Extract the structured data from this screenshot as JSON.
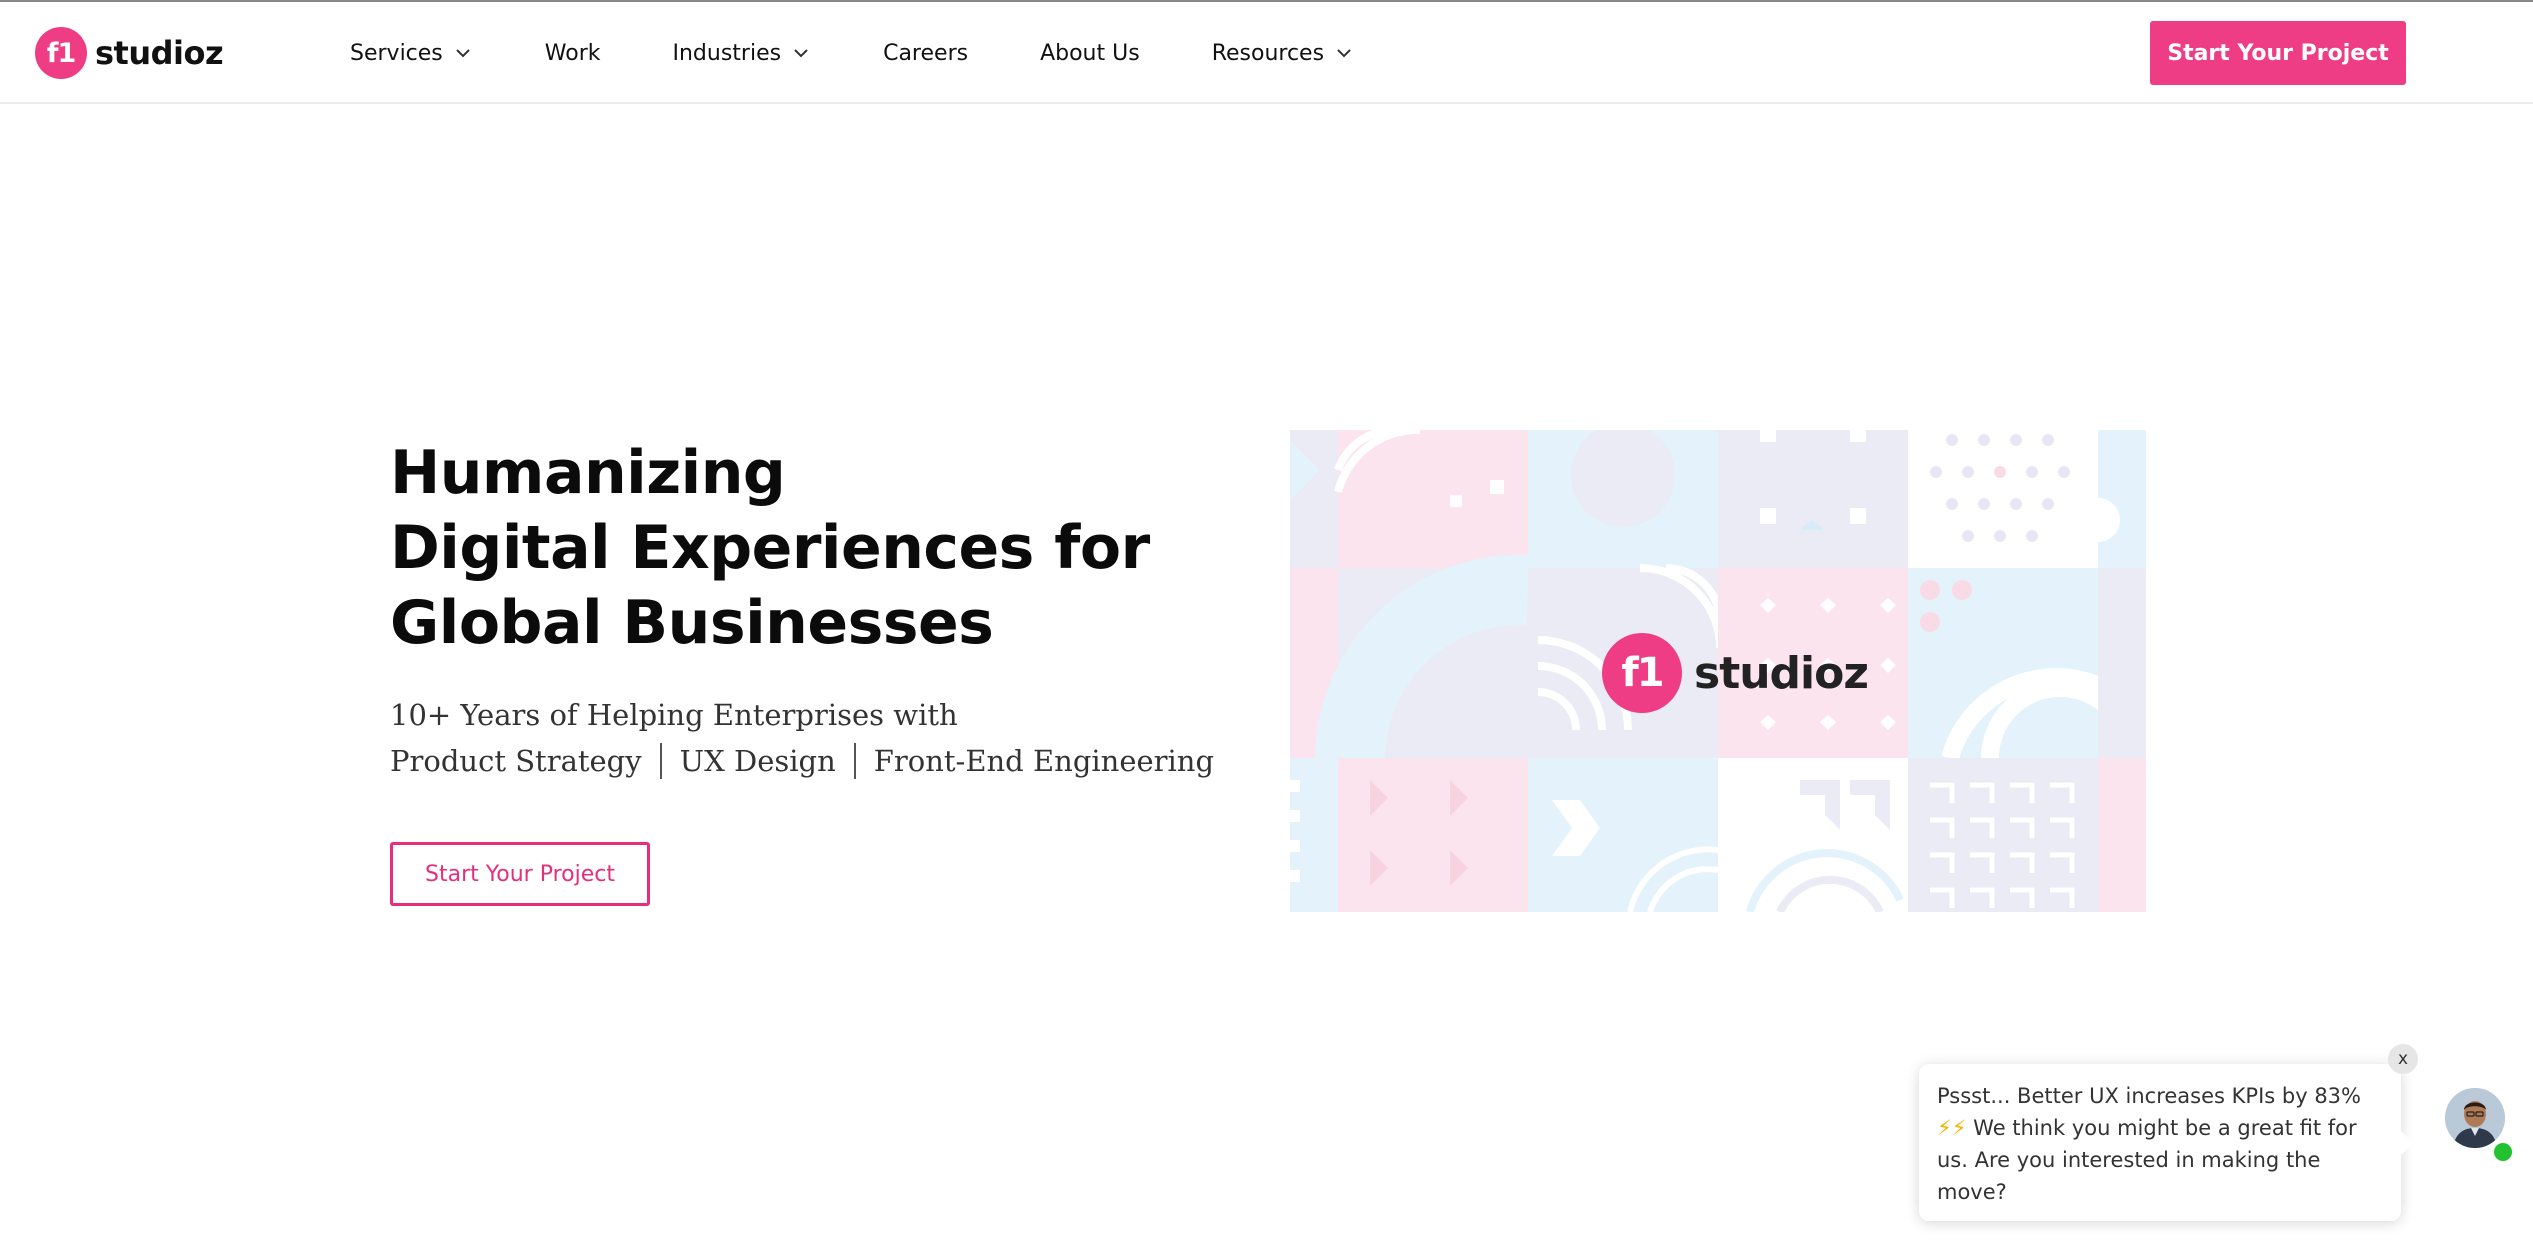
{
  "header": {
    "logo_badge": "f1",
    "logo_word": "studioz",
    "nav": [
      {
        "label": "Services",
        "has_dropdown": true
      },
      {
        "label": "Work",
        "has_dropdown": false
      },
      {
        "label": "Industries",
        "has_dropdown": true
      },
      {
        "label": "Careers",
        "has_dropdown": false
      },
      {
        "label": "About Us",
        "has_dropdown": false
      },
      {
        "label": "Resources",
        "has_dropdown": true
      }
    ],
    "cta_label": "Start Your Project"
  },
  "hero": {
    "title_lines": [
      "Humanizing",
      "Digital Experiences for",
      "Global Businesses"
    ],
    "subtitle_line1": "10+ Years of Helping Enterprises with",
    "subtitle_items": [
      "Product Strategy",
      "UX Design",
      "Front-End Engineering"
    ],
    "cta_label": "Start Your Project",
    "art_logo_badge": "f1",
    "art_logo_word": "studioz"
  },
  "chat": {
    "close_label": "x",
    "message_start": "Pssst... Better UX increases KPIs by 83% ",
    "bolts": "⚡⚡",
    "message_end": " We think you might be a great fit for us. Are you interested in making the move?"
  },
  "colors": {
    "brand_pink": "#ef3d85",
    "online_green": "#21c12f"
  },
  "icons": [
    "chevron-down-icon",
    "close-icon",
    "lightning-icon",
    "avatar"
  ]
}
